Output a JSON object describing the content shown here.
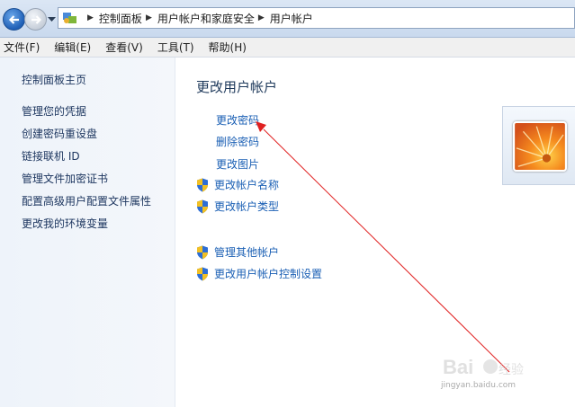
{
  "breadcrumb": [
    "控制面板",
    "用户帐户和家庭安全",
    "用户帐户"
  ],
  "menu": [
    "文件(F)",
    "编辑(E)",
    "查看(V)",
    "工具(T)",
    "帮助(H)"
  ],
  "sidebar": {
    "items": [
      "控制面板主页",
      "管理您的凭据",
      "创建密码重设盘",
      "链接联机 ID",
      "管理文件加密证书",
      "配置高级用户配置文件属性",
      "更改我的环境变量"
    ]
  },
  "main": {
    "title": "更改用户帐户",
    "tasks": [
      "更改密码",
      "删除密码",
      "更改图片",
      "更改帐户名称",
      "更改帐户类型"
    ],
    "other_tasks": [
      "管理其他帐户",
      "更改用户帐户控制设置"
    ]
  },
  "colors": {
    "link": "#1a5fb4",
    "annotation_arrow": "#e02020"
  },
  "watermark": {
    "logo": "Baidu经验",
    "url": "jingyan.baidu.com"
  }
}
